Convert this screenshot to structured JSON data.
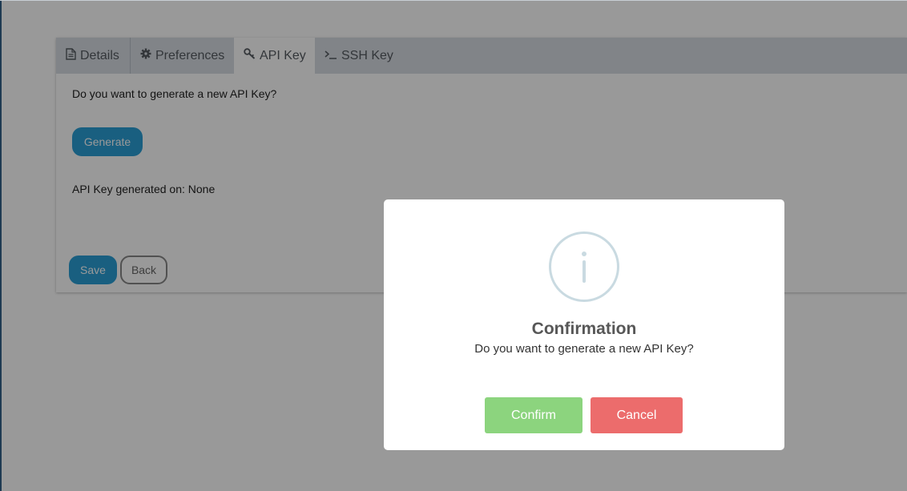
{
  "tabs": [
    {
      "label": "Details",
      "icon": "file-icon",
      "active": false
    },
    {
      "label": "Preferences",
      "icon": "gear-icon",
      "active": false
    },
    {
      "label": "API Key",
      "icon": "key-icon",
      "active": true
    },
    {
      "label": "SSH Key",
      "icon": "terminal-icon",
      "active": false
    }
  ],
  "content": {
    "question": "Do you want to generate a new API Key?",
    "generate_label": "Generate",
    "generated_on": "API Key generated on: None",
    "save_label": "Save",
    "back_label": "Back"
  },
  "modal": {
    "icon": "info-icon",
    "title": "Confirmation",
    "message": "Do you want to generate a new API Key?",
    "confirm_label": "Confirm",
    "cancel_label": "Cancel"
  },
  "colors": {
    "primary": "#2a9fd6",
    "confirm": "#8cd47e",
    "cancel": "#ec6c6c",
    "info_icon": "#c9dae1"
  }
}
